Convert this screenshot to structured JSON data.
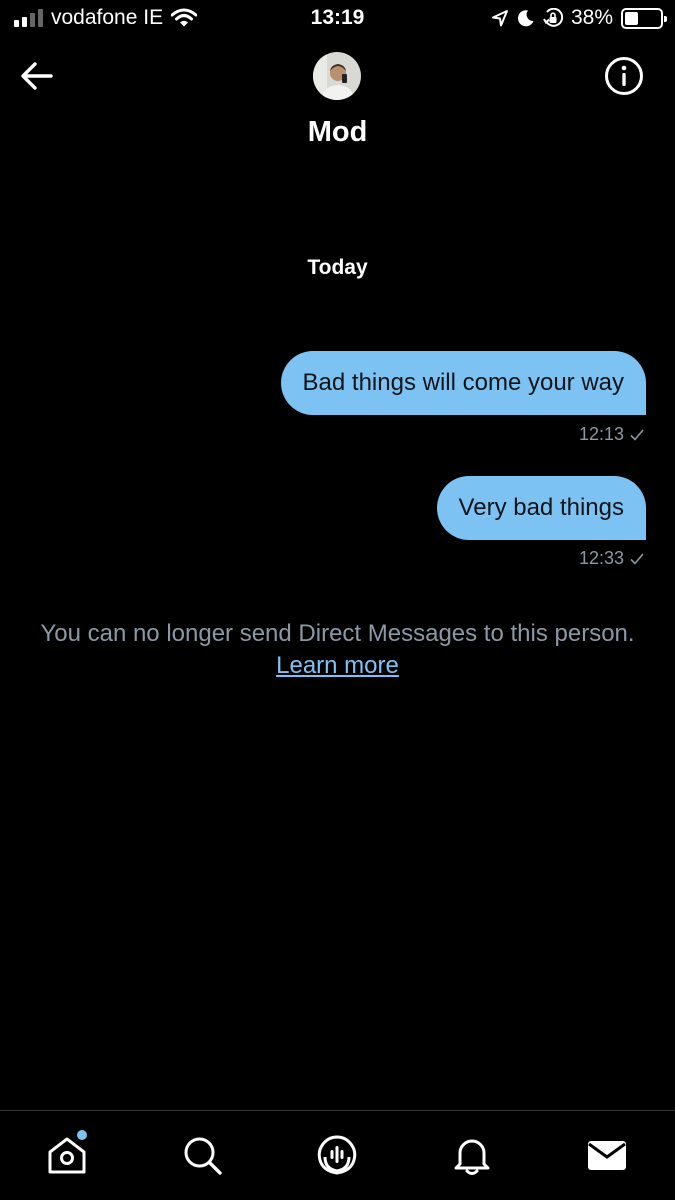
{
  "status_bar": {
    "carrier": "vodafone IE",
    "time": "13:19",
    "battery_percent_label": "38%",
    "battery_level": 0.38
  },
  "header": {
    "title": "Mod"
  },
  "conversation": {
    "date_separator": "Today",
    "messages": [
      {
        "text": "Bad things will come your way",
        "time": "12:13",
        "status": "sent"
      },
      {
        "text": "Very bad things",
        "time": "12:33",
        "status": "sent"
      }
    ],
    "notice": {
      "text": "You can no longer send Direct Messages to this person.",
      "link_label": "Learn more"
    }
  },
  "bottom_nav": {
    "items": [
      "home-icon",
      "search-icon",
      "spaces-icon",
      "notifications-icon",
      "messages-icon"
    ]
  },
  "colors": {
    "background": "#000000",
    "bubble": "#7cc3f4",
    "muted_text": "#8b98a5",
    "link": "#7cc3f4"
  }
}
